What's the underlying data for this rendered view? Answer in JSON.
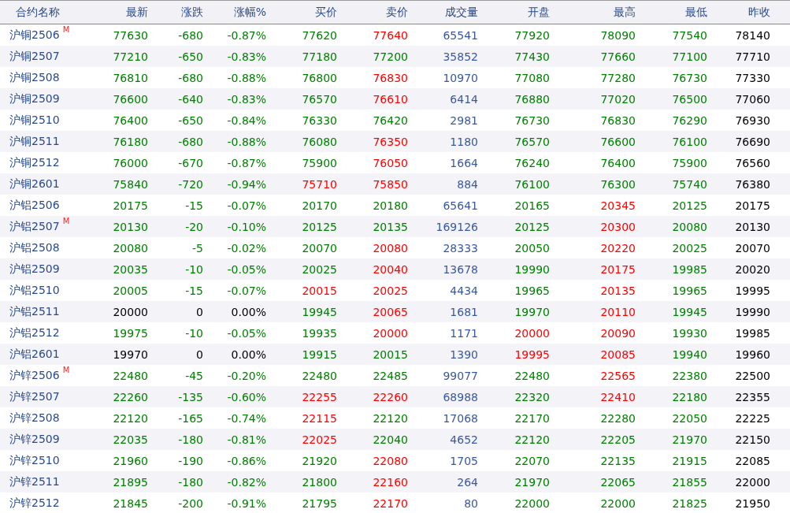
{
  "table": {
    "columns": [
      "合约名称",
      "最新",
      "涨跌",
      "涨幅%",
      "买价",
      "卖价",
      "成交量",
      "开盘",
      "最高",
      "最低",
      "昨收"
    ],
    "rows": [
      {
        "cells": [
          {
            "text": "沪铜2506",
            "badge": "M"
          },
          {
            "text": "77630",
            "color": "#008000"
          },
          {
            "text": "-680",
            "color": "#008000"
          },
          {
            "text": "-0.87%",
            "color": "#008000"
          },
          {
            "text": "77620",
            "color": "#008000"
          },
          {
            "text": "77640",
            "color": "#ff0000"
          },
          {
            "text": "65541",
            "color": "#3858a0"
          },
          {
            "text": "77920",
            "color": "#008000"
          },
          {
            "text": "78090",
            "color": "#008000"
          },
          {
            "text": "77540",
            "color": "#008000"
          },
          {
            "text": "78140",
            "color": "#000000"
          }
        ]
      },
      {
        "cells": [
          {
            "text": "沪铜2507"
          },
          {
            "text": "77210",
            "color": "#008000"
          },
          {
            "text": "-650",
            "color": "#008000"
          },
          {
            "text": "-0.83%",
            "color": "#008000"
          },
          {
            "text": "77180",
            "color": "#008000"
          },
          {
            "text": "77200",
            "color": "#008000"
          },
          {
            "text": "35852",
            "color": "#3858a0"
          },
          {
            "text": "77430",
            "color": "#008000"
          },
          {
            "text": "77660",
            "color": "#008000"
          },
          {
            "text": "77100",
            "color": "#008000"
          },
          {
            "text": "77710",
            "color": "#000000"
          }
        ]
      },
      {
        "cells": [
          {
            "text": "沪铜2508"
          },
          {
            "text": "76810",
            "color": "#008000"
          },
          {
            "text": "-680",
            "color": "#008000"
          },
          {
            "text": "-0.88%",
            "color": "#008000"
          },
          {
            "text": "76800",
            "color": "#008000"
          },
          {
            "text": "76830",
            "color": "#ff0000"
          },
          {
            "text": "10970",
            "color": "#3858a0"
          },
          {
            "text": "77080",
            "color": "#008000"
          },
          {
            "text": "77280",
            "color": "#008000"
          },
          {
            "text": "76730",
            "color": "#008000"
          },
          {
            "text": "77330",
            "color": "#000000"
          }
        ]
      },
      {
        "cells": [
          {
            "text": "沪铜2509"
          },
          {
            "text": "76600",
            "color": "#008000"
          },
          {
            "text": "-640",
            "color": "#008000"
          },
          {
            "text": "-0.83%",
            "color": "#008000"
          },
          {
            "text": "76570",
            "color": "#008000"
          },
          {
            "text": "76610",
            "color": "#ff0000"
          },
          {
            "text": "6414",
            "color": "#3858a0"
          },
          {
            "text": "76880",
            "color": "#008000"
          },
          {
            "text": "77020",
            "color": "#008000"
          },
          {
            "text": "76500",
            "color": "#008000"
          },
          {
            "text": "77060",
            "color": "#000000"
          }
        ]
      },
      {
        "cells": [
          {
            "text": "沪铜2510"
          },
          {
            "text": "76400",
            "color": "#008000"
          },
          {
            "text": "-650",
            "color": "#008000"
          },
          {
            "text": "-0.84%",
            "color": "#008000"
          },
          {
            "text": "76330",
            "color": "#008000"
          },
          {
            "text": "76420",
            "color": "#008000"
          },
          {
            "text": "2981",
            "color": "#3858a0"
          },
          {
            "text": "76730",
            "color": "#008000"
          },
          {
            "text": "76830",
            "color": "#008000"
          },
          {
            "text": "76290",
            "color": "#008000"
          },
          {
            "text": "76930",
            "color": "#000000"
          }
        ]
      },
      {
        "cells": [
          {
            "text": "沪铜2511"
          },
          {
            "text": "76180",
            "color": "#008000"
          },
          {
            "text": "-680",
            "color": "#008000"
          },
          {
            "text": "-0.88%",
            "color": "#008000"
          },
          {
            "text": "76080",
            "color": "#008000"
          },
          {
            "text": "76350",
            "color": "#ff0000"
          },
          {
            "text": "1180",
            "color": "#3858a0"
          },
          {
            "text": "76570",
            "color": "#008000"
          },
          {
            "text": "76600",
            "color": "#008000"
          },
          {
            "text": "76100",
            "color": "#008000"
          },
          {
            "text": "76690",
            "color": "#000000"
          }
        ]
      },
      {
        "cells": [
          {
            "text": "沪铜2512"
          },
          {
            "text": "76000",
            "color": "#008000"
          },
          {
            "text": "-670",
            "color": "#008000"
          },
          {
            "text": "-0.87%",
            "color": "#008000"
          },
          {
            "text": "75900",
            "color": "#008000"
          },
          {
            "text": "76050",
            "color": "#ff0000"
          },
          {
            "text": "1664",
            "color": "#3858a0"
          },
          {
            "text": "76240",
            "color": "#008000"
          },
          {
            "text": "76400",
            "color": "#008000"
          },
          {
            "text": "75900",
            "color": "#008000"
          },
          {
            "text": "76560",
            "color": "#000000"
          }
        ]
      },
      {
        "cells": [
          {
            "text": "沪铜2601"
          },
          {
            "text": "75840",
            "color": "#008000"
          },
          {
            "text": "-720",
            "color": "#008000"
          },
          {
            "text": "-0.94%",
            "color": "#008000"
          },
          {
            "text": "75710",
            "color": "#ff0000"
          },
          {
            "text": "75850",
            "color": "#ff0000"
          },
          {
            "text": "884",
            "color": "#3858a0"
          },
          {
            "text": "76100",
            "color": "#008000"
          },
          {
            "text": "76300",
            "color": "#008000"
          },
          {
            "text": "75740",
            "color": "#008000"
          },
          {
            "text": "76380",
            "color": "#000000"
          }
        ]
      },
      {
        "cells": [
          {
            "text": "沪铝2506"
          },
          {
            "text": "20175",
            "color": "#008000"
          },
          {
            "text": "-15",
            "color": "#008000"
          },
          {
            "text": "-0.07%",
            "color": "#008000"
          },
          {
            "text": "20170",
            "color": "#008000"
          },
          {
            "text": "20180",
            "color": "#008000"
          },
          {
            "text": "65641",
            "color": "#3858a0"
          },
          {
            "text": "20165",
            "color": "#008000"
          },
          {
            "text": "20345",
            "color": "#ff0000"
          },
          {
            "text": "20125",
            "color": "#008000"
          },
          {
            "text": "20175",
            "color": "#000000"
          }
        ]
      },
      {
        "cells": [
          {
            "text": "沪铝2507",
            "badge": "M"
          },
          {
            "text": "20130",
            "color": "#008000"
          },
          {
            "text": "-20",
            "color": "#008000"
          },
          {
            "text": "-0.10%",
            "color": "#008000"
          },
          {
            "text": "20125",
            "color": "#008000"
          },
          {
            "text": "20135",
            "color": "#008000"
          },
          {
            "text": "169126",
            "color": "#3858a0"
          },
          {
            "text": "20125",
            "color": "#008000"
          },
          {
            "text": "20300",
            "color": "#ff0000"
          },
          {
            "text": "20080",
            "color": "#008000"
          },
          {
            "text": "20130",
            "color": "#000000"
          }
        ]
      },
      {
        "cells": [
          {
            "text": "沪铝2508"
          },
          {
            "text": "20080",
            "color": "#008000"
          },
          {
            "text": "-5",
            "color": "#008000"
          },
          {
            "text": "-0.02%",
            "color": "#008000"
          },
          {
            "text": "20070",
            "color": "#008000"
          },
          {
            "text": "20080",
            "color": "#ff0000"
          },
          {
            "text": "28333",
            "color": "#3858a0"
          },
          {
            "text": "20050",
            "color": "#008000"
          },
          {
            "text": "20220",
            "color": "#ff0000"
          },
          {
            "text": "20025",
            "color": "#008000"
          },
          {
            "text": "20070",
            "color": "#000000"
          }
        ]
      },
      {
        "cells": [
          {
            "text": "沪铝2509"
          },
          {
            "text": "20035",
            "color": "#008000"
          },
          {
            "text": "-10",
            "color": "#008000"
          },
          {
            "text": "-0.05%",
            "color": "#008000"
          },
          {
            "text": "20025",
            "color": "#008000"
          },
          {
            "text": "20040",
            "color": "#ff0000"
          },
          {
            "text": "13678",
            "color": "#3858a0"
          },
          {
            "text": "19990",
            "color": "#008000"
          },
          {
            "text": "20175",
            "color": "#ff0000"
          },
          {
            "text": "19985",
            "color": "#008000"
          },
          {
            "text": "20020",
            "color": "#000000"
          }
        ]
      },
      {
        "cells": [
          {
            "text": "沪铝2510"
          },
          {
            "text": "20005",
            "color": "#008000"
          },
          {
            "text": "-15",
            "color": "#008000"
          },
          {
            "text": "-0.07%",
            "color": "#008000"
          },
          {
            "text": "20015",
            "color": "#ff0000"
          },
          {
            "text": "20025",
            "color": "#ff0000"
          },
          {
            "text": "4434",
            "color": "#3858a0"
          },
          {
            "text": "19965",
            "color": "#008000"
          },
          {
            "text": "20135",
            "color": "#ff0000"
          },
          {
            "text": "19965",
            "color": "#008000"
          },
          {
            "text": "19995",
            "color": "#000000"
          }
        ]
      },
      {
        "cells": [
          {
            "text": "沪铝2511"
          },
          {
            "text": "20000",
            "color": "#000000"
          },
          {
            "text": "0",
            "color": "#000000"
          },
          {
            "text": "0.00%",
            "color": "#000000"
          },
          {
            "text": "19945",
            "color": "#008000"
          },
          {
            "text": "20065",
            "color": "#ff0000"
          },
          {
            "text": "1681",
            "color": "#3858a0"
          },
          {
            "text": "19970",
            "color": "#008000"
          },
          {
            "text": "20110",
            "color": "#ff0000"
          },
          {
            "text": "19945",
            "color": "#008000"
          },
          {
            "text": "19990",
            "color": "#000000"
          }
        ]
      },
      {
        "cells": [
          {
            "text": "沪铝2512"
          },
          {
            "text": "19975",
            "color": "#008000"
          },
          {
            "text": "-10",
            "color": "#008000"
          },
          {
            "text": "-0.05%",
            "color": "#008000"
          },
          {
            "text": "19935",
            "color": "#008000"
          },
          {
            "text": "20000",
            "color": "#ff0000"
          },
          {
            "text": "1171",
            "color": "#3858a0"
          },
          {
            "text": "20000",
            "color": "#ff0000"
          },
          {
            "text": "20090",
            "color": "#ff0000"
          },
          {
            "text": "19930",
            "color": "#008000"
          },
          {
            "text": "19985",
            "color": "#000000"
          }
        ]
      },
      {
        "cells": [
          {
            "text": "沪铝2601"
          },
          {
            "text": "19970",
            "color": "#000000"
          },
          {
            "text": "0",
            "color": "#000000"
          },
          {
            "text": "0.00%",
            "color": "#000000"
          },
          {
            "text": "19915",
            "color": "#008000"
          },
          {
            "text": "20015",
            "color": "#008000"
          },
          {
            "text": "1390",
            "color": "#3858a0"
          },
          {
            "text": "19995",
            "color": "#ff0000"
          },
          {
            "text": "20085",
            "color": "#ff0000"
          },
          {
            "text": "19940",
            "color": "#008000"
          },
          {
            "text": "19960",
            "color": "#000000"
          }
        ]
      },
      {
        "cells": [
          {
            "text": "沪锌2506",
            "badge": "M"
          },
          {
            "text": "22480",
            "color": "#008000"
          },
          {
            "text": "-45",
            "color": "#008000"
          },
          {
            "text": "-0.20%",
            "color": "#008000"
          },
          {
            "text": "22480",
            "color": "#008000"
          },
          {
            "text": "22485",
            "color": "#008000"
          },
          {
            "text": "99077",
            "color": "#3858a0"
          },
          {
            "text": "22480",
            "color": "#008000"
          },
          {
            "text": "22565",
            "color": "#ff0000"
          },
          {
            "text": "22380",
            "color": "#008000"
          },
          {
            "text": "22500",
            "color": "#000000"
          }
        ]
      },
      {
        "cells": [
          {
            "text": "沪锌2507"
          },
          {
            "text": "22260",
            "color": "#008000"
          },
          {
            "text": "-135",
            "color": "#008000"
          },
          {
            "text": "-0.60%",
            "color": "#008000"
          },
          {
            "text": "22255",
            "color": "#ff0000"
          },
          {
            "text": "22260",
            "color": "#ff0000"
          },
          {
            "text": "68988",
            "color": "#3858a0"
          },
          {
            "text": "22320",
            "color": "#008000"
          },
          {
            "text": "22410",
            "color": "#ff0000"
          },
          {
            "text": "22180",
            "color": "#008000"
          },
          {
            "text": "22355",
            "color": "#000000"
          }
        ]
      },
      {
        "cells": [
          {
            "text": "沪锌2508"
          },
          {
            "text": "22120",
            "color": "#008000"
          },
          {
            "text": "-165",
            "color": "#008000"
          },
          {
            "text": "-0.74%",
            "color": "#008000"
          },
          {
            "text": "22115",
            "color": "#ff0000"
          },
          {
            "text": "22120",
            "color": "#008000"
          },
          {
            "text": "17068",
            "color": "#3858a0"
          },
          {
            "text": "22170",
            "color": "#008000"
          },
          {
            "text": "22280",
            "color": "#008000"
          },
          {
            "text": "22050",
            "color": "#008000"
          },
          {
            "text": "22225",
            "color": "#000000"
          }
        ]
      },
      {
        "cells": [
          {
            "text": "沪锌2509"
          },
          {
            "text": "22035",
            "color": "#008000"
          },
          {
            "text": "-180",
            "color": "#008000"
          },
          {
            "text": "-0.81%",
            "color": "#008000"
          },
          {
            "text": "22025",
            "color": "#ff0000"
          },
          {
            "text": "22040",
            "color": "#008000"
          },
          {
            "text": "4652",
            "color": "#3858a0"
          },
          {
            "text": "22120",
            "color": "#008000"
          },
          {
            "text": "22205",
            "color": "#008000"
          },
          {
            "text": "21970",
            "color": "#008000"
          },
          {
            "text": "22150",
            "color": "#000000"
          }
        ]
      },
      {
        "cells": [
          {
            "text": "沪锌2510"
          },
          {
            "text": "21960",
            "color": "#008000"
          },
          {
            "text": "-190",
            "color": "#008000"
          },
          {
            "text": "-0.86%",
            "color": "#008000"
          },
          {
            "text": "21920",
            "color": "#008000"
          },
          {
            "text": "22080",
            "color": "#ff0000"
          },
          {
            "text": "1705",
            "color": "#3858a0"
          },
          {
            "text": "22070",
            "color": "#008000"
          },
          {
            "text": "22135",
            "color": "#008000"
          },
          {
            "text": "21915",
            "color": "#008000"
          },
          {
            "text": "22085",
            "color": "#000000"
          }
        ]
      },
      {
        "cells": [
          {
            "text": "沪锌2511"
          },
          {
            "text": "21895",
            "color": "#008000"
          },
          {
            "text": "-180",
            "color": "#008000"
          },
          {
            "text": "-0.82%",
            "color": "#008000"
          },
          {
            "text": "21800",
            "color": "#008000"
          },
          {
            "text": "22160",
            "color": "#ff0000"
          },
          {
            "text": "264",
            "color": "#3858a0"
          },
          {
            "text": "21970",
            "color": "#008000"
          },
          {
            "text": "22065",
            "color": "#008000"
          },
          {
            "text": "21855",
            "color": "#008000"
          },
          {
            "text": "22000",
            "color": "#000000"
          }
        ]
      },
      {
        "cells": [
          {
            "text": "沪锌2512"
          },
          {
            "text": "21845",
            "color": "#008000"
          },
          {
            "text": "-200",
            "color": "#008000"
          },
          {
            "text": "-0.91%",
            "color": "#008000"
          },
          {
            "text": "21795",
            "color": "#008000"
          },
          {
            "text": "22170",
            "color": "#ff0000"
          },
          {
            "text": "80",
            "color": "#3858a0"
          },
          {
            "text": "22000",
            "color": "#008000"
          },
          {
            "text": "22000",
            "color": "#008000"
          },
          {
            "text": "21825",
            "color": "#008000"
          },
          {
            "text": "21950",
            "color": "#000000"
          }
        ]
      }
    ]
  }
}
